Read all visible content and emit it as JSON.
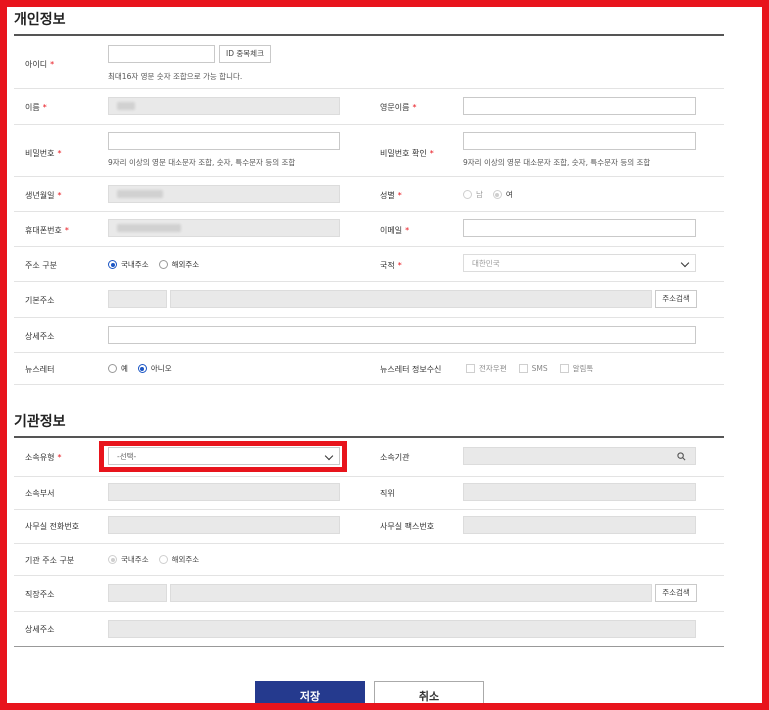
{
  "personal": {
    "section_title": "개인정보",
    "id_label": "아이디",
    "id_check_button": "ID 중복체크",
    "id_hint": "최대16자 영문 숫자 조합으로 가능 합니다.",
    "name_label": "이름",
    "eng_name_label": "영문이름",
    "password_label": "비밀번호",
    "password_hint": "9자리 이상의 영문 대소문자 조합, 숫자, 특수문자 등의 조합",
    "password_confirm_label": "비밀번호 확인",
    "password_confirm_hint": "9자리 이상의 영문 대소문자 조합, 숫자, 특수문자 등의 조합",
    "birth_label": "생년월일",
    "gender_label": "성별",
    "gender_options": [
      "남",
      "여"
    ],
    "gender_selected": "여",
    "mobile_label": "휴대폰번호",
    "email_label": "이메일",
    "address_type_label": "주소 구분",
    "address_type_options": [
      "국내주소",
      "해외주소"
    ],
    "address_type_selected": "국내주소",
    "nationality_label": "국적",
    "nationality_value": "대한민국",
    "basic_address_label": "기본주소",
    "address_search_button": "주소검색",
    "detail_address_label": "상세주소",
    "newsletter_label": "뉴스레터",
    "newsletter_options": [
      "예",
      "아니오"
    ],
    "newsletter_selected": "아니오",
    "newsletter_channel_label": "뉴스레터 정보수신",
    "newsletter_channels": [
      "전자우편",
      "SMS",
      "알림톡"
    ]
  },
  "organization": {
    "section_title": "기관정보",
    "affiliation_type_label": "소속유형",
    "affiliation_type_value": "-선택-",
    "affiliation_org_label": "소속기관",
    "department_label": "소속부서",
    "position_label": "직위",
    "office_phone_label": "사무실 전화번호",
    "office_fax_label": "사무실 팩스번호",
    "org_address_type_label": "기관 주소 구분",
    "org_address_type_options": [
      "국내주소",
      "해외주소"
    ],
    "org_address_type_selected": "국내주소",
    "work_address_label": "직장주소",
    "address_search_button": "주소검색",
    "detail_address_label": "상세주소"
  },
  "actions": {
    "save": "저장",
    "cancel": "취소"
  },
  "colors": {
    "required_mark": "#e8141c",
    "highlight_border": "#e8141c",
    "primary_button": "#253a8e",
    "radio_selected": "#1a55c4"
  }
}
